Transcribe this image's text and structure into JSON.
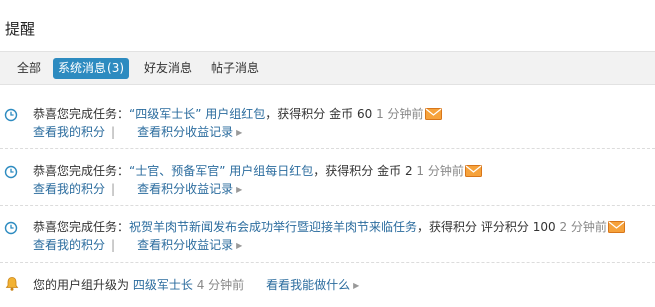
{
  "page_title": "提醒",
  "tabs": [
    {
      "label": "全部"
    },
    {
      "label": "系统消息",
      "count": "(3)"
    },
    {
      "label": "好友消息"
    },
    {
      "label": "帖子消息"
    }
  ],
  "notices": [
    {
      "prefix": "恭喜您完成任务：",
      "task": "“四级军士长” 用户组红包",
      "suffix": "，获得积分",
      "reward": "金币",
      "amount": "60",
      "time": "1 分钟前",
      "link1": "查看我的积分",
      "link2": "查看积分收益记录"
    },
    {
      "prefix": "恭喜您完成任务：",
      "task": "“士官、预备军官” 用户组每日红包",
      "suffix": "，获得积分",
      "reward": "金币",
      "amount": "2",
      "time": "1 分钟前",
      "link1": "查看我的积分",
      "link2": "查看积分收益记录"
    },
    {
      "prefix": "恭喜您完成任务：",
      "task": "祝贺羊肉节新闻发布会成功举行暨迎接羊肉节来临任务",
      "suffix": "，获得积分",
      "reward": "评分积分",
      "amount": "100",
      "time": "2 分钟前",
      "link1": "查看我的积分",
      "link2": "查看积分收益记录"
    }
  ],
  "upgrade": {
    "prefix": "您的用户组升级为",
    "group": "四级军士长",
    "time": "4 分钟前",
    "link": "看看我能做什么"
  },
  "colors": {
    "accent": "#2d8bc0",
    "link": "#2b6c9e",
    "time": "#888888",
    "mail_icon": "#f08a1c"
  }
}
